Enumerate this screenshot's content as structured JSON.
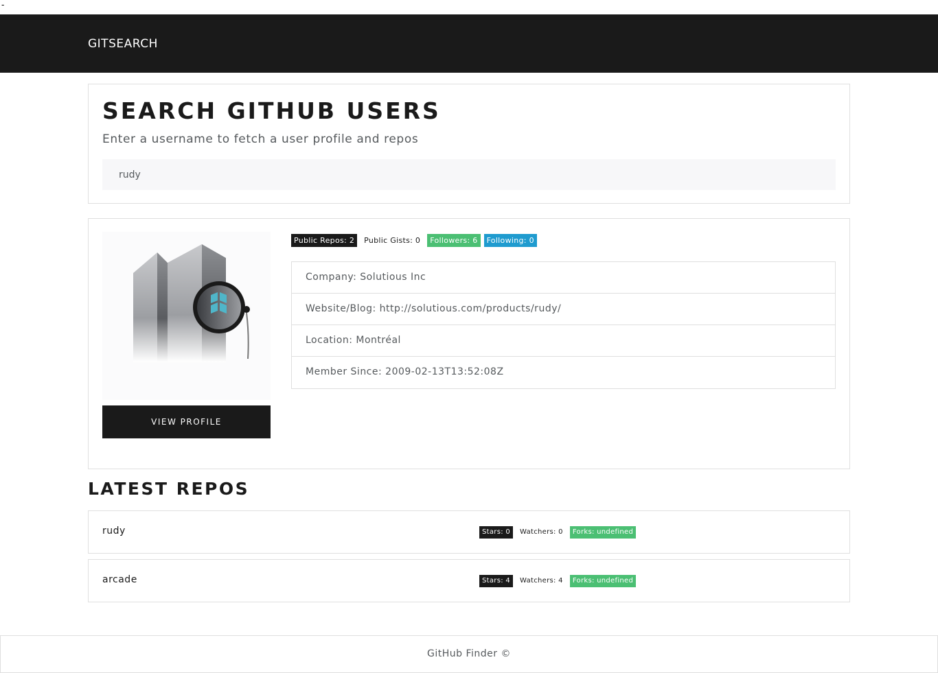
{
  "page": {
    "top_text": "-"
  },
  "navbar": {
    "brand": "GITSEARCH"
  },
  "search": {
    "title": "SEARCH GITHUB USERS",
    "lead": "Enter a username to fetch a user profile and repos",
    "input_value": "rudy",
    "placeholder": ""
  },
  "profile": {
    "button_label": "VIEW PROFILE",
    "badges": {
      "public_repos": "Public Repos: 2",
      "public_gists": "Public Gists: 0",
      "followers": "Followers: 6",
      "following": "Following: 0"
    },
    "info": [
      {
        "text": "Company: Solutious Inc"
      },
      {
        "text": "Website/Blog: http://solutious.com/products/rudy/"
      },
      {
        "text": "Location: Montréal"
      },
      {
        "text": "Member Since: 2009-02-13T13:52:08Z"
      }
    ]
  },
  "repos": {
    "heading": "LATEST REPOS",
    "items": [
      {
        "name": "rudy",
        "stars": "Stars: 0",
        "watchers": "Watchers: 0",
        "forks": "Forks: undefined"
      },
      {
        "name": "arcade",
        "stars": "Stars: 4",
        "watchers": "Watchers: 4",
        "forks": "Forks: undefined"
      }
    ]
  },
  "footer": {
    "text": "GitHub Finder ©"
  },
  "colors": {
    "dark": "#1a1a1a",
    "success": "#4bbf73",
    "info": "#1f9bcf",
    "border": "#dfdfdf",
    "input_bg": "#f7f7f9"
  }
}
